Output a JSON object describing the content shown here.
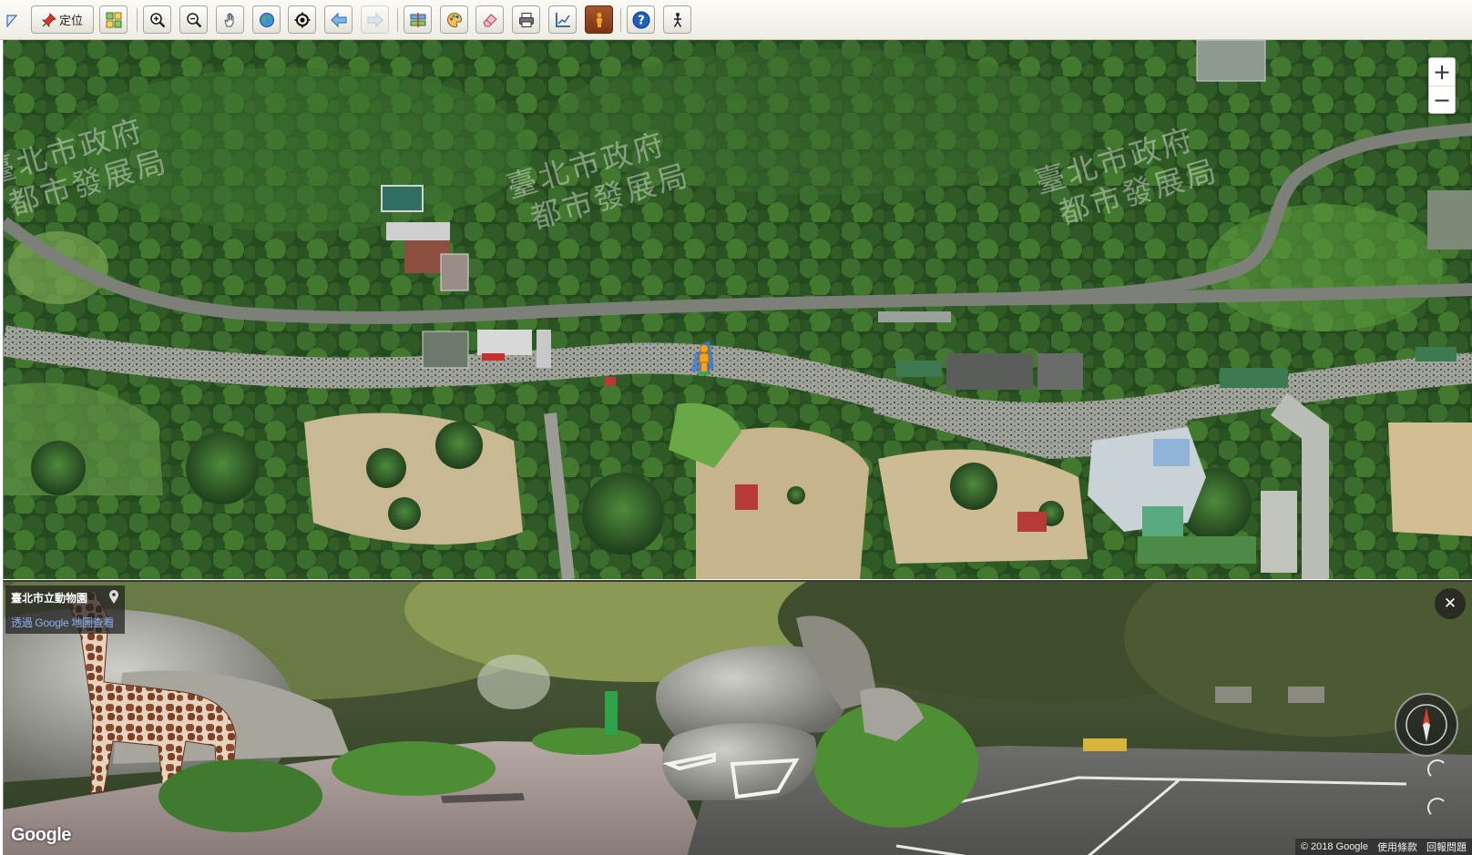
{
  "toolbar": {
    "corner_icon": "select-arrow-icon",
    "locate_label": "定位",
    "buttons": [
      {
        "name": "locate-button",
        "icon": "pushpin-icon"
      },
      {
        "name": "layers-button",
        "icon": "grid-layers-icon"
      },
      {
        "name": "zoom-in-button",
        "icon": "magnifier-plus-icon"
      },
      {
        "name": "zoom-out-button",
        "icon": "magnifier-minus-icon"
      },
      {
        "name": "pan-button",
        "icon": "hand-icon"
      },
      {
        "name": "full-extent-button",
        "icon": "globe-icon"
      },
      {
        "name": "center-button",
        "icon": "crosshair-icon"
      },
      {
        "name": "back-button",
        "icon": "arrow-left-icon"
      },
      {
        "name": "forward-button",
        "icon": "arrow-right-icon",
        "disabled": true
      },
      {
        "name": "compare-button",
        "icon": "compare-icon"
      },
      {
        "name": "basemap-button",
        "icon": "palette-icon"
      },
      {
        "name": "eraser-button",
        "icon": "eraser-icon"
      },
      {
        "name": "print-button",
        "icon": "printer-icon"
      },
      {
        "name": "measure-button",
        "icon": "measure-icon"
      },
      {
        "name": "streetview-button",
        "icon": "pegman-icon",
        "active": true
      },
      {
        "name": "help-button",
        "icon": "help-icon"
      },
      {
        "name": "accessibility-button",
        "icon": "person-icon"
      }
    ]
  },
  "map": {
    "watermark": {
      "line1": "臺北市政府",
      "line2": "都市發展局"
    },
    "zoom_in": "+",
    "zoom_out": "−"
  },
  "streetview": {
    "place_name": "臺北市立動物園",
    "view_link": "透過 Google 地圖查看",
    "close": "✕",
    "logo": "Google",
    "copyright": "© 2018 Google",
    "terms": "使用條款",
    "report": "回報問題"
  },
  "colors": {
    "toolbar_bg": "#efede4",
    "active_button": "#8a3e1a",
    "help_blue": "#1f5fbf",
    "link_blue": "#8ab4f8"
  }
}
